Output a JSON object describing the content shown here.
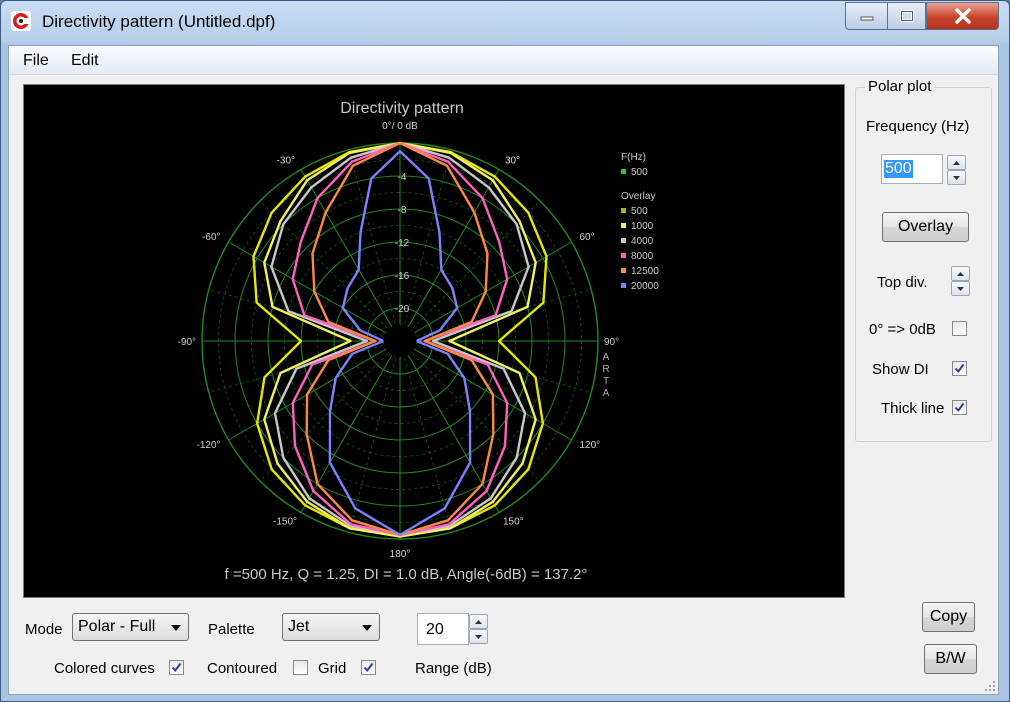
{
  "window": {
    "title": "Directivity pattern (Untitled.dpf)",
    "icon": "arta-logo-icon"
  },
  "menu": {
    "items": [
      "File",
      "Edit"
    ]
  },
  "plot": {
    "title": "Directivity pattern",
    "info_line": "f =500 Hz,  Q =  1.25,  DI =   1.0 dB, Angle(-6dB) = 137.2°",
    "watermark": [
      "A",
      "R",
      "T",
      "A"
    ],
    "angle_labels": {
      "top": "0°/ 0 dB",
      "a30r": "30°",
      "a60r": "60°",
      "a90r": "90°",
      "a120r": "120°",
      "a150r": "150°",
      "bottom": "180°",
      "a30l": "-30°",
      "a60l": "-60°",
      "a90l": "-90°",
      "a120l": "-120°",
      "a150l": "-150°"
    },
    "ring_labels": [
      "-4",
      "-8",
      "-12",
      "-16",
      "-20"
    ],
    "legend": {
      "fhz_title": "F(Hz)",
      "current": {
        "label": "500",
        "color": "#22cc22"
      },
      "overlay_title": "Overlay",
      "overlay": [
        {
          "label": "500",
          "color": "#b8b000"
        },
        {
          "label": "1000",
          "color": "#f0f060"
        },
        {
          "label": "4000",
          "color": "#c8c8c8"
        },
        {
          "label": "8000",
          "color": "#ff60c0"
        },
        {
          "label": "12500",
          "color": "#ff8840"
        },
        {
          "label": "20000",
          "color": "#8080ff"
        }
      ]
    }
  },
  "chart_data": {
    "type": "polar",
    "title": "Directivity pattern",
    "radial_range_db": [
      -24,
      0
    ],
    "radial_ticks_db": [
      -4,
      -8,
      -12,
      -16,
      -20
    ],
    "angle_ticks_deg": [
      0,
      30,
      60,
      90,
      120,
      150,
      180,
      -150,
      -120,
      -90,
      -60,
      -30
    ],
    "series": [
      {
        "name": "500",
        "color": "#e6e600",
        "points_deg_db": [
          [
            0,
            0
          ],
          [
            15,
            -0.3
          ],
          [
            30,
            -1
          ],
          [
            45,
            -2
          ],
          [
            60,
            -3.5
          ],
          [
            75,
            -6
          ],
          [
            90,
            -12
          ],
          [
            105,
            -7
          ],
          [
            120,
            -4
          ],
          [
            135,
            -2
          ],
          [
            150,
            -1
          ],
          [
            165,
            -0.5
          ],
          [
            180,
            -0.3
          ]
        ]
      },
      {
        "name": "1000",
        "color": "#f0f060",
        "points_deg_db": [
          [
            0,
            0
          ],
          [
            15,
            -0.4
          ],
          [
            30,
            -1.5
          ],
          [
            45,
            -3.5
          ],
          [
            60,
            -5
          ],
          [
            75,
            -8
          ],
          [
            90,
            -18
          ],
          [
            105,
            -9
          ],
          [
            120,
            -5
          ],
          [
            135,
            -3
          ],
          [
            150,
            -1.5
          ],
          [
            165,
            -0.5
          ],
          [
            180,
            -0.3
          ]
        ]
      },
      {
        "name": "4000",
        "color": "#c8c8c8",
        "points_deg_db": [
          [
            0,
            0
          ],
          [
            15,
            -1
          ],
          [
            30,
            -2.5
          ],
          [
            45,
            -4
          ],
          [
            60,
            -6
          ],
          [
            75,
            -10
          ],
          [
            90,
            -20
          ],
          [
            105,
            -11
          ],
          [
            120,
            -6.5
          ],
          [
            135,
            -4
          ],
          [
            150,
            -2
          ],
          [
            165,
            -0.8
          ],
          [
            180,
            -0.5
          ]
        ]
      },
      {
        "name": "8000",
        "color": "#ff60c0",
        "points_deg_db": [
          [
            0,
            0
          ],
          [
            15,
            -1.5
          ],
          [
            30,
            -4
          ],
          [
            45,
            -7
          ],
          [
            60,
            -9
          ],
          [
            75,
            -12
          ],
          [
            90,
            -21
          ],
          [
            105,
            -13
          ],
          [
            120,
            -9
          ],
          [
            135,
            -6
          ],
          [
            150,
            -3
          ],
          [
            165,
            -1
          ],
          [
            180,
            -0.5
          ]
        ]
      },
      {
        "name": "12500",
        "color": "#ff8840",
        "points_deg_db": [
          [
            0,
            0
          ],
          [
            15,
            -2
          ],
          [
            30,
            -6
          ],
          [
            45,
            -9
          ],
          [
            60,
            -12
          ],
          [
            75,
            -15
          ],
          [
            90,
            -21
          ],
          [
            105,
            -15
          ],
          [
            120,
            -11
          ],
          [
            135,
            -8
          ],
          [
            150,
            -4
          ],
          [
            165,
            -1.5
          ],
          [
            180,
            -0.5
          ]
        ]
      },
      {
        "name": "20000",
        "color": "#8080ff",
        "points_deg_db": [
          [
            0,
            -1
          ],
          [
            10,
            -4
          ],
          [
            20,
            -10
          ],
          [
            30,
            -14
          ],
          [
            45,
            -15
          ],
          [
            60,
            -16
          ],
          [
            75,
            -19
          ],
          [
            90,
            -22
          ],
          [
            105,
            -18
          ],
          [
            120,
            -15
          ],
          [
            135,
            -12
          ],
          [
            150,
            -7
          ],
          [
            165,
            -3
          ],
          [
            180,
            -0.5
          ]
        ]
      }
    ]
  },
  "polar_panel": {
    "title": "Polar plot",
    "frequency_label": "Frequency (Hz)",
    "frequency_value": "500",
    "overlay_button": "Overlay",
    "top_div_label": "Top div.",
    "zero_db_label": "0° => 0dB",
    "zero_db_checked": false,
    "show_di_label": "Show DI",
    "show_di_checked": true,
    "thick_line_label": "Thick line",
    "thick_line_checked": true
  },
  "bottom": {
    "mode_label": "Mode",
    "mode_value": "Polar - Full",
    "palette_label": "Palette",
    "palette_value": "Jet",
    "range_value": "20",
    "range_label": "Range (dB)",
    "colored_curves_label": "Colored curves",
    "colored_curves_checked": true,
    "contoured_label": "Contoured",
    "contoured_checked": false,
    "grid_label": "Grid",
    "grid_checked": true,
    "copy_button": "Copy",
    "bw_button": "B/W"
  }
}
